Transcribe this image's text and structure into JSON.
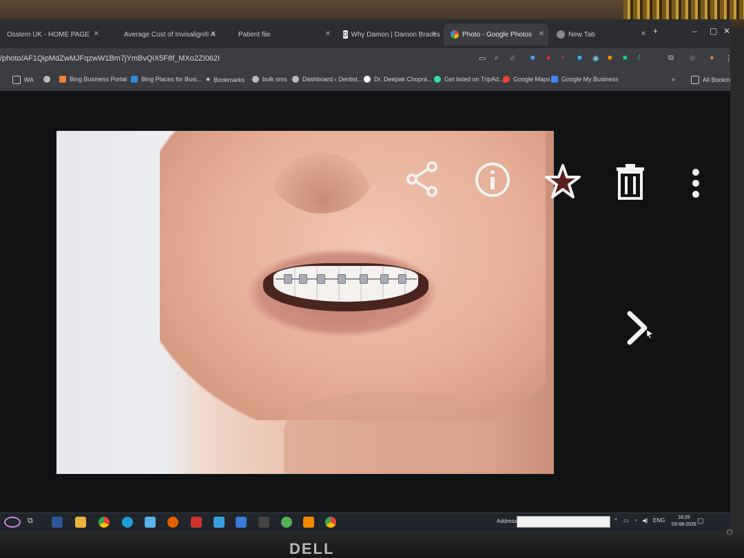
{
  "tabs": [
    {
      "label": "Osstem UK - HOME PAGE",
      "active": false
    },
    {
      "label": "Average Cost of Invisalign® A",
      "active": false
    },
    {
      "label": "Patient file",
      "active": false
    },
    {
      "label": "Why Damon | Damon Braces",
      "active": false
    },
    {
      "label": "Photo - Google Photos",
      "active": true
    },
    {
      "label": "New Tab",
      "active": false
    }
  ],
  "tab_new_glyph": "+",
  "window_controls": {
    "minimize": "–",
    "maximize": "▢",
    "close": "✕"
  },
  "address": {
    "url": "/photo/AF1QipMdZwMJFqzwW1Bm7jYmBvQiX5F8f_MXo2ZI062I"
  },
  "bookmarks": [
    {
      "label": "WA",
      "icon": "folder-icon",
      "color": "#dcdcdc"
    },
    {
      "label": "",
      "icon": "globe-icon",
      "color": "#cfcfcf"
    },
    {
      "label": "Bing Business Portal",
      "icon": "bing-icon",
      "color": "#f0803c"
    },
    {
      "label": "Bing Places for Busi...",
      "icon": "bing-icon",
      "color": "#2a8cd8"
    },
    {
      "label": "Bookmarks",
      "icon": "star-icon",
      "color": "#dcdcdc"
    },
    {
      "label": "bulk sms",
      "icon": "globe-icon",
      "color": "#cfcfcf"
    },
    {
      "label": "Dashboard ‹ Dentist...",
      "icon": "globe-icon",
      "color": "#cfcfcf"
    },
    {
      "label": "Dr. Deepak Chopra...",
      "icon": "google-icon",
      "color": "#ffffff"
    },
    {
      "label": "Get listed on TripAd...",
      "icon": "tripadvisor-icon",
      "color": "#34e0a1"
    },
    {
      "label": "Google Maps",
      "icon": "maps-icon",
      "color": "#ea4335"
    },
    {
      "label": "Google My Business",
      "icon": "gmb-icon",
      "color": "#4285f4"
    }
  ],
  "all_bookmarks_label": "All Bookmarks",
  "viewer": {
    "share_icon": "share-icon",
    "info_icon": "info-icon",
    "favorite_icon": "star-icon",
    "delete_icon": "trash-icon",
    "more_icon": "more-vert-icon",
    "next_glyph": "›"
  },
  "taskbar": {
    "address_label": "Address",
    "language": "ENG",
    "time": "16:25",
    "date": "03-08-2025"
  },
  "monitor_brand": "DELL",
  "colors": {
    "viewer_bg": "#111214",
    "chrome_dark": "#2b2d31",
    "toolbar": "#3b3d42"
  }
}
